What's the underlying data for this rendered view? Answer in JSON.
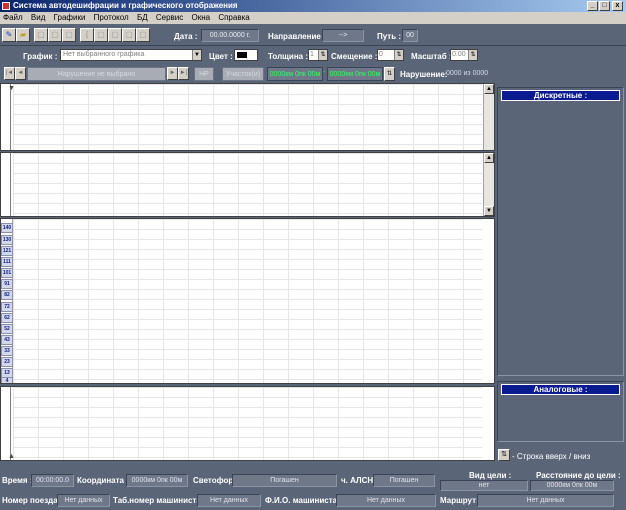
{
  "window": {
    "title": "Система автодешифрации и графического отображения",
    "controls": [
      "_",
      "□",
      "x"
    ]
  },
  "menu": [
    "Файл",
    "Вид",
    "Графики",
    "Протокол",
    "БД",
    "Сервис",
    "Окна",
    "Справка"
  ],
  "header": {
    "date_label": "Дата :",
    "date_value": "00.00.0000 г.",
    "direction_label": "Направление :",
    "direction_value": "-->",
    "path_label": "Путь :",
    "path_value": "00"
  },
  "graph_row": {
    "graph_label": "График :",
    "graph_value": "Нет выбранного графика",
    "color_label": "Цвет :",
    "thickness_label": "Толщина :",
    "thickness_value": "1",
    "offset_label": "Смещение :",
    "offset_value": "0",
    "scale_label": "Масштаб :",
    "scale_value": "0.00"
  },
  "violation_row": {
    "violation_select": "Нарушение не выбрано",
    "np_button": "НР",
    "section_button": "Участок(и)",
    "range_from": "0000км 0пк 00м",
    "range_sep": "-",
    "range_to": "0000км 0пк 00м",
    "violation_label": "Нарушение:",
    "violation_count": "0000 из 0000"
  },
  "yaxis_ticks": [
    "140",
    "130",
    "121",
    "111",
    "101",
    "91",
    "82",
    "72",
    "62",
    "52",
    "43",
    "33",
    "23",
    "13",
    "4"
  ],
  "right_panel": {
    "discrete_title": "Дискретные :",
    "analog_title": "Аналоговые :",
    "row_toggle": "- Строка вверх / вниз"
  },
  "status1": {
    "time_label": "Время :",
    "time_value": "00:00:00.0",
    "coord_label": "Координата :",
    "coord_value": "0000км 0пк 00м",
    "signal_label": "Светофор :",
    "signal_value": "Погашен",
    "alsn_label": "ч. АЛСН:",
    "alsn_value": "Погашен",
    "target_label": "Вид цели :",
    "target_value": "нет",
    "distance_label": "Расстояние до цели :",
    "distance_value": "0000км 0пк 00м"
  },
  "status2": {
    "train_label": "Номер поезда:",
    "train_value": "Нет данных",
    "driver_num_label": "Таб.номер машиниста:",
    "driver_num_value": "Нет данных",
    "driver_name_label": "Ф.И.О. машиниста:",
    "driver_name_value": "Нет данных",
    "route_label": "Маршрут:",
    "route_value": "Нет данных"
  }
}
